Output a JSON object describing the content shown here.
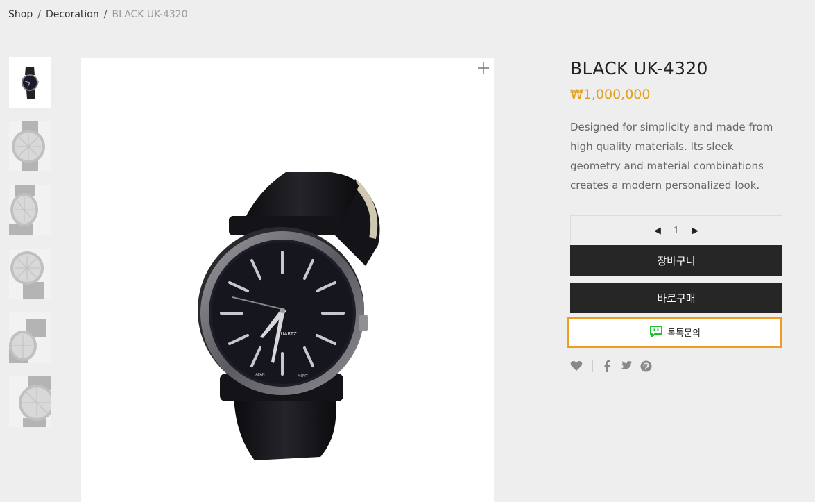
{
  "breadcrumb": {
    "items": [
      "Shop",
      "Decoration"
    ],
    "current": "BLACK UK-4320",
    "separator": "/"
  },
  "product": {
    "title": "BLACK UK-4320",
    "price": "₩1,000,000",
    "description": "Designed for simplicity and made from high quality materials. Its sleek geometry and material combinations creates a modern personalized look.",
    "watch_text": {
      "brand": "QUARTZ",
      "left": "JAPAN",
      "right": "MOVT"
    }
  },
  "quantity": {
    "value": "1",
    "decrease_icon": "◀",
    "increase_icon": "▶"
  },
  "buttons": {
    "cart": "장바구니",
    "buy": "바로구매",
    "talk": "톡톡문의"
  },
  "thumbnails": [
    {
      "name": "thumb-1",
      "active": true
    },
    {
      "name": "thumb-2",
      "active": false
    },
    {
      "name": "thumb-3",
      "active": false
    },
    {
      "name": "thumb-4",
      "active": false
    },
    {
      "name": "thumb-5",
      "active": false
    },
    {
      "name": "thumb-6",
      "active": false
    }
  ],
  "icons": {
    "zoom": "plus-icon",
    "wishlist": "heart-icon",
    "facebook": "facebook-icon",
    "twitter": "twitter-icon",
    "pinterest": "pinterest-icon",
    "talk": "chat-bubble-icon"
  },
  "colors": {
    "price": "#e0a01e",
    "button_dark": "#262626",
    "talk_border": "#f39a22",
    "talk_icon": "#19c12b"
  }
}
